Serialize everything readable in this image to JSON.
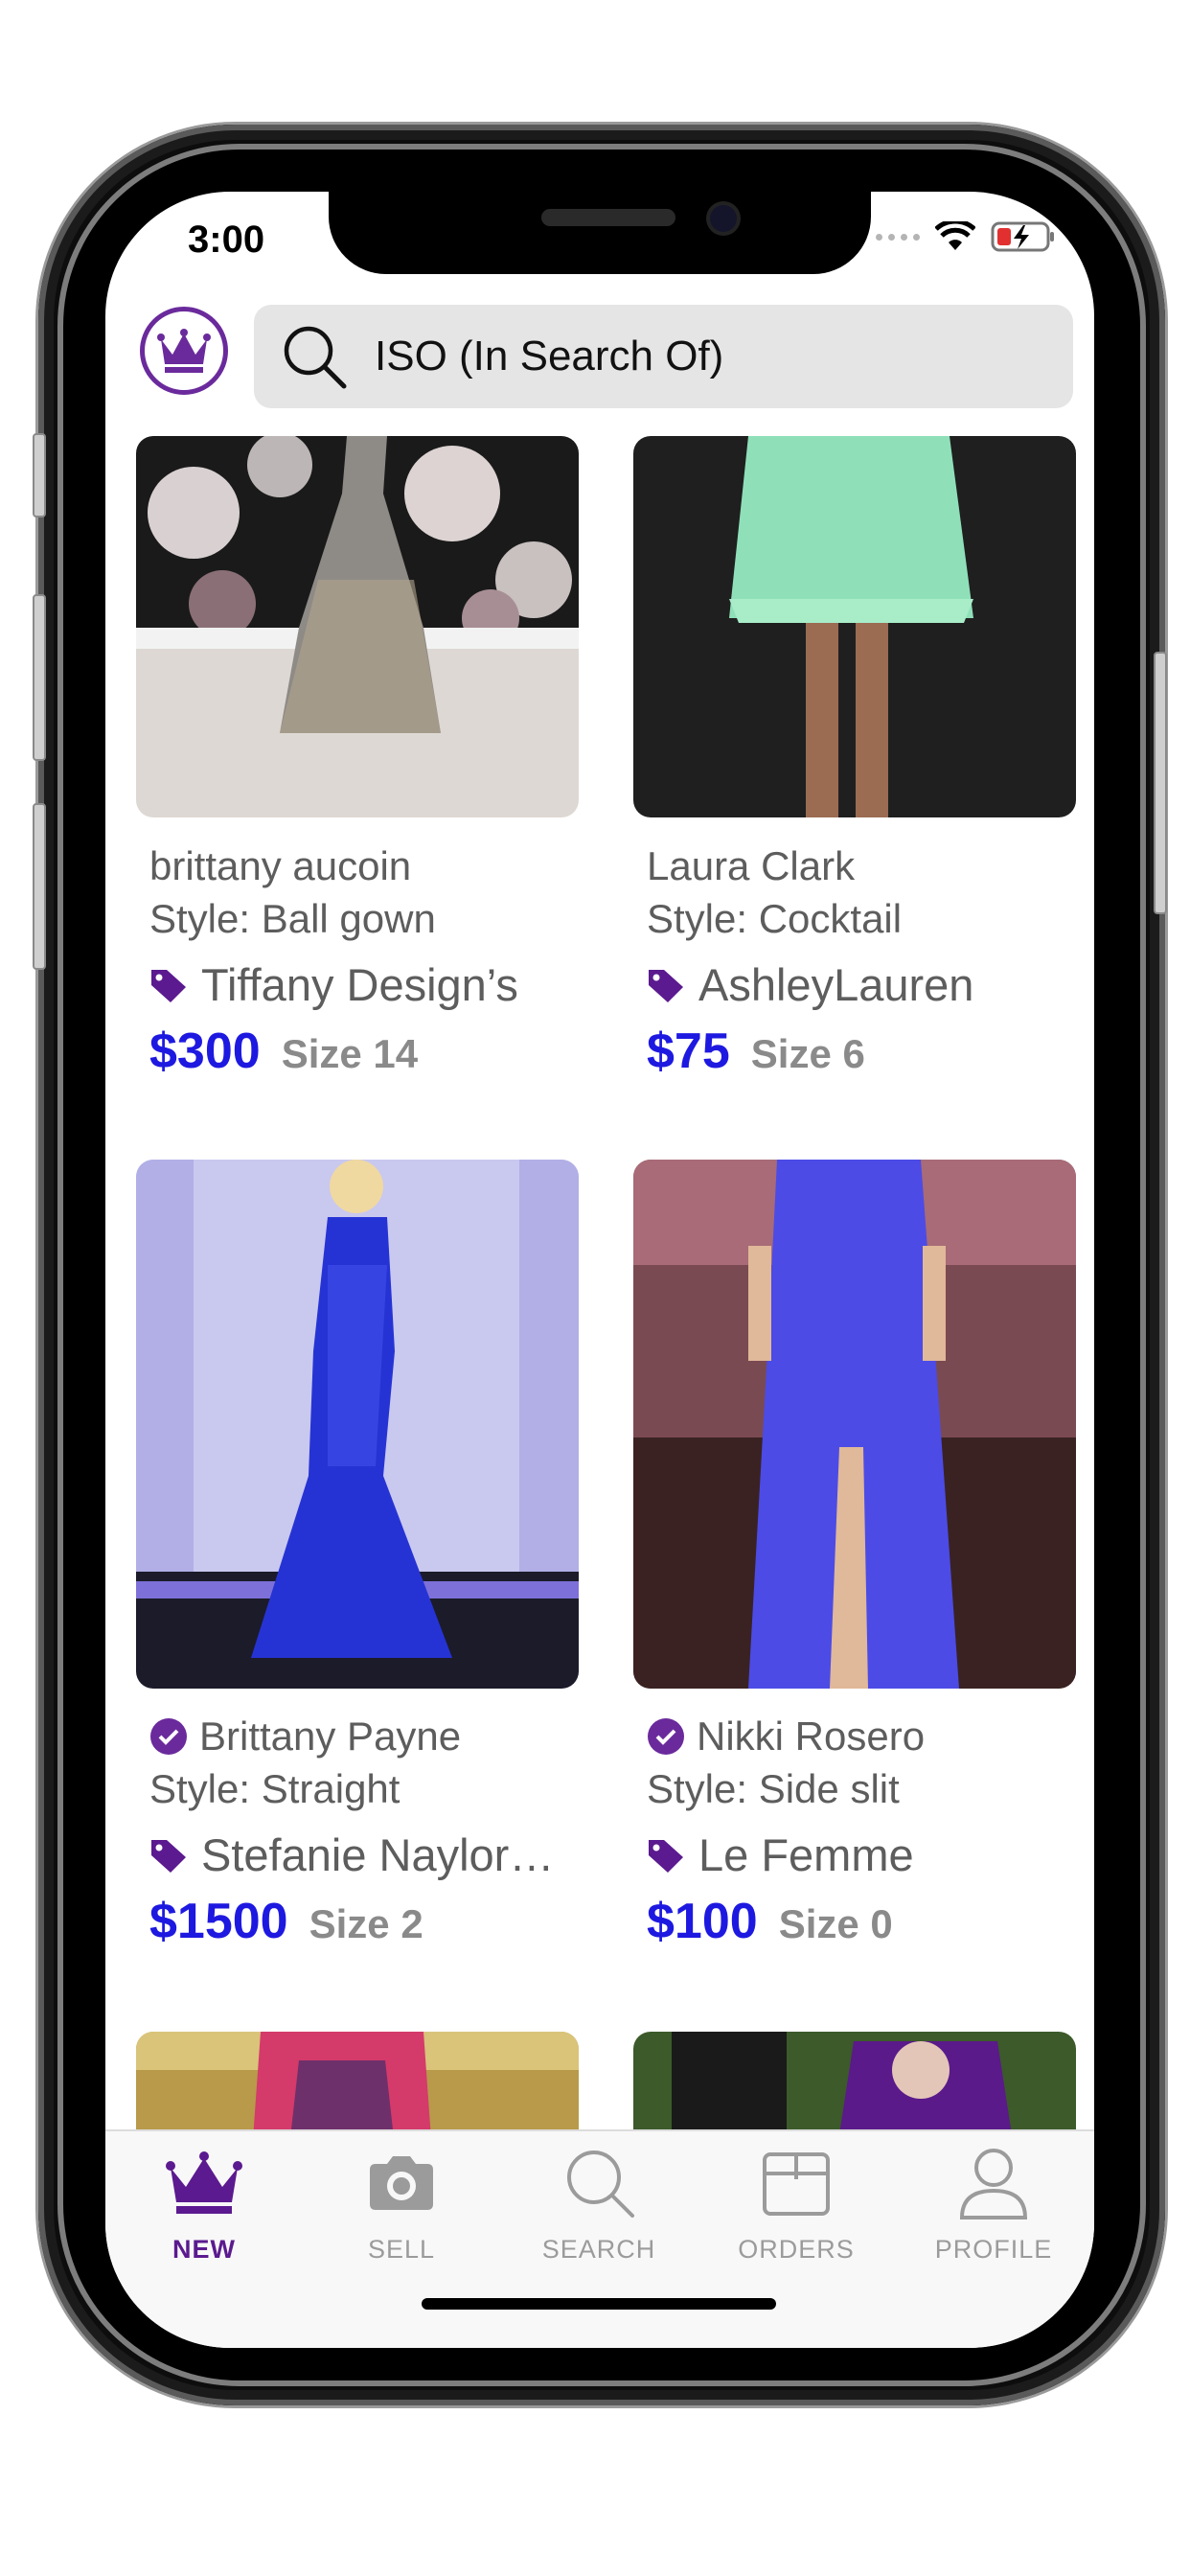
{
  "status_bar": {
    "time": "3:00"
  },
  "search": {
    "placeholder": "ISO (In Search Of)"
  },
  "colors": {
    "accent": "#5b1a8f",
    "price": "#1e19e0",
    "muted": "#8a8a8a"
  },
  "listings": [
    {
      "seller": "brittany aucoin",
      "verified": false,
      "style": "Style: Ball gown",
      "brand": "Tiffany Design’s",
      "price": "$300",
      "size": "Size 14"
    },
    {
      "seller": "Laura Clark",
      "verified": false,
      "style": "Style: Cocktail",
      "brand": "AshleyLauren",
      "price": "$75",
      "size": "Size 6"
    },
    {
      "seller": "Brittany Payne",
      "verified": true,
      "style": "Style: Straight",
      "brand": "Stefanie Naylor…",
      "price": "$1500",
      "size": "Size 2"
    },
    {
      "seller": "Nikki Rosero",
      "verified": true,
      "style": "Style: Side slit",
      "brand": "Le Femme",
      "price": "$100",
      "size": "Size 0"
    }
  ],
  "tabbar": {
    "tabs": [
      {
        "label": "NEW",
        "icon": "crown-icon",
        "active": true
      },
      {
        "label": "SELL",
        "icon": "camera-icon",
        "active": false
      },
      {
        "label": "SEARCH",
        "icon": "search-icon",
        "active": false
      },
      {
        "label": "ORDERS",
        "icon": "box-icon",
        "active": false
      },
      {
        "label": "PROFILE",
        "icon": "person-icon",
        "active": false
      }
    ]
  }
}
